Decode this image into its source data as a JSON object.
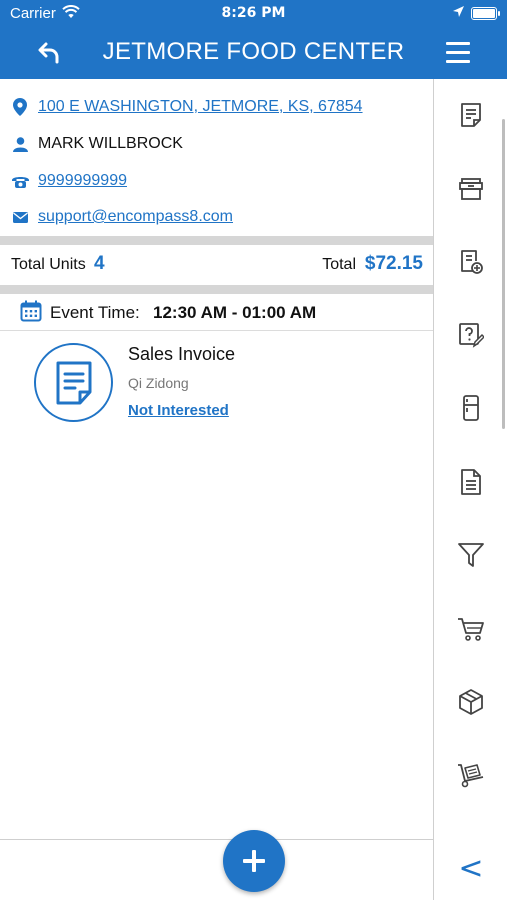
{
  "status_bar": {
    "carrier": "Carrier",
    "time": "8:26 PM"
  },
  "header": {
    "title": "JETMORE FOOD CENTER"
  },
  "contact": {
    "address": "100 E WASHINGTON, JETMORE, KS, 67854",
    "name": "MARK WILLBROCK",
    "phone": "9999999999",
    "email": "support@encompass8.com"
  },
  "totals": {
    "units_label": "Total Units",
    "units_value": "4",
    "total_label": "Total",
    "total_value": "$72.15"
  },
  "event": {
    "label": "Event Time:",
    "value": "12:30 AM - 01:00 AM"
  },
  "invoice": {
    "title": "Sales Invoice",
    "user": "Qi Zidong",
    "status": "Not Interested"
  },
  "sidebar_icons": [
    "note-icon",
    "archive-box-icon",
    "add-document-icon",
    "question-edit-icon",
    "refrigerator-icon",
    "document-list-icon",
    "filter-icon",
    "cart-icon",
    "package-icon",
    "hand-truck-icon"
  ],
  "sidebar": {
    "collapse_label": "<"
  },
  "colors": {
    "primary": "#2074c6",
    "band": "#d6d6d6"
  }
}
